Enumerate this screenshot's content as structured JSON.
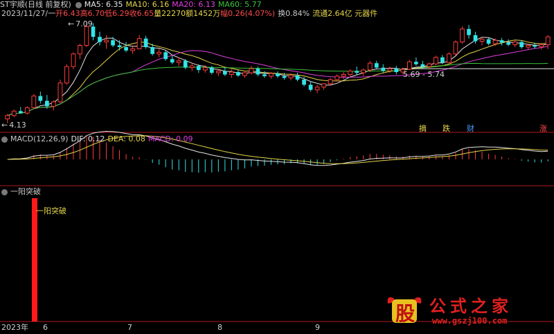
{
  "header": {
    "stock": "ST宇顺(日线 前复权)",
    "ma5": "MA5: 6.35",
    "ma10": "MA10: 6.16",
    "ma20": "MA20: 6.13",
    "ma60": "MA60: 5.77",
    "quote": {
      "date": "2023/11/27/一",
      "open": "开6.43",
      "high": "高6.70",
      "low": "低6.29",
      "close": "收6.65",
      "volume": "量22270",
      "amount": "额1452万",
      "change": "幅0.26(4.07%)",
      "turnover": "换0.84%",
      "float": "流通2.64亿 元器件"
    }
  },
  "macd_header": {
    "name": "MACD(12,26,9)",
    "dif": "DIF: 0.12",
    "dea": "DEA: 0.08",
    "macd": "MACD: 0.09"
  },
  "indicator_header": {
    "name": "一阳突破",
    "bar_label": "一阳突破"
  },
  "price_labels": {
    "high_mark": "7.09",
    "low_mark": "4.13",
    "range_mark": "5.69 - 5.74"
  },
  "markers": [
    "摘",
    "跌",
    "财",
    "涨"
  ],
  "x_axis": [
    "2023年",
    "6",
    "7",
    "8",
    "9"
  ],
  "watermark": {
    "logo_char": "股",
    "brand": "公式之家",
    "url": "www.gszj100.com"
  },
  "colors": {
    "up": "#ff3c3c",
    "down": "#33e3e6",
    "ma5": "#e6e6e6",
    "ma10": "#e6d44a",
    "ma20": "#e03ee0",
    "ma60": "#3cc43c",
    "panel_border": "#b01818",
    "signal": "#ff1a1a"
  },
  "chart_data": {
    "type": "candlestick",
    "title": "ST宇顺(日线 前复权)",
    "x": [
      "2023年",
      "6",
      "7",
      "8",
      "9"
    ],
    "ylim": [
      4.0,
      7.2
    ],
    "candles": [
      {
        "o": 4.25,
        "h": 4.4,
        "l": 4.13,
        "c": 4.35
      },
      {
        "o": 4.35,
        "h": 4.52,
        "l": 4.3,
        "c": 4.48
      },
      {
        "o": 4.48,
        "h": 4.6,
        "l": 4.4,
        "c": 4.42
      },
      {
        "o": 4.42,
        "h": 4.62,
        "l": 4.38,
        "c": 4.58
      },
      {
        "o": 4.58,
        "h": 4.98,
        "l": 4.55,
        "c": 4.92
      },
      {
        "o": 4.92,
        "h": 5.05,
        "l": 4.7,
        "c": 4.78
      },
      {
        "o": 4.78,
        "h": 4.95,
        "l": 4.55,
        "c": 4.62
      },
      {
        "o": 4.62,
        "h": 4.8,
        "l": 4.5,
        "c": 4.75
      },
      {
        "o": 4.75,
        "h": 5.4,
        "l": 4.72,
        "c": 5.3
      },
      {
        "o": 5.3,
        "h": 5.85,
        "l": 5.25,
        "c": 5.78
      },
      {
        "o": 5.78,
        "h": 6.2,
        "l": 5.7,
        "c": 6.15
      },
      {
        "o": 6.15,
        "h": 6.45,
        "l": 6.0,
        "c": 6.4
      },
      {
        "o": 6.4,
        "h": 7.09,
        "l": 6.35,
        "c": 6.95
      },
      {
        "o": 6.95,
        "h": 7.05,
        "l": 6.55,
        "c": 6.65
      },
      {
        "o": 6.65,
        "h": 6.8,
        "l": 6.4,
        "c": 6.5
      },
      {
        "o": 6.5,
        "h": 6.7,
        "l": 6.3,
        "c": 6.55
      },
      {
        "o": 6.55,
        "h": 6.65,
        "l": 6.35,
        "c": 6.4
      },
      {
        "o": 6.4,
        "h": 6.55,
        "l": 6.25,
        "c": 6.35
      },
      {
        "o": 6.35,
        "h": 6.5,
        "l": 6.2,
        "c": 6.25
      },
      {
        "o": 6.25,
        "h": 6.4,
        "l": 6.15,
        "c": 6.3
      },
      {
        "o": 6.3,
        "h": 6.7,
        "l": 6.28,
        "c": 6.6
      },
      {
        "o": 6.6,
        "h": 6.68,
        "l": 6.3,
        "c": 6.35
      },
      {
        "o": 6.35,
        "h": 6.45,
        "l": 6.1,
        "c": 6.15
      },
      {
        "o": 6.15,
        "h": 6.3,
        "l": 6.05,
        "c": 6.2
      },
      {
        "o": 6.2,
        "h": 6.25,
        "l": 5.95,
        "c": 6.0
      },
      {
        "o": 6.0,
        "h": 6.1,
        "l": 5.85,
        "c": 5.9
      },
      {
        "o": 5.9,
        "h": 6.05,
        "l": 5.8,
        "c": 5.95
      },
      {
        "o": 5.95,
        "h": 6.0,
        "l": 5.7,
        "c": 5.75
      },
      {
        "o": 5.75,
        "h": 5.9,
        "l": 5.65,
        "c": 5.8
      },
      {
        "o": 5.8,
        "h": 5.85,
        "l": 5.6,
        "c": 5.68
      },
      {
        "o": 5.68,
        "h": 5.82,
        "l": 5.6,
        "c": 5.75
      },
      {
        "o": 5.75,
        "h": 5.8,
        "l": 5.55,
        "c": 5.6
      },
      {
        "o": 5.6,
        "h": 5.72,
        "l": 5.5,
        "c": 5.65
      },
      {
        "o": 5.65,
        "h": 5.75,
        "l": 5.5,
        "c": 5.55
      },
      {
        "o": 5.55,
        "h": 5.7,
        "l": 5.45,
        "c": 5.62
      },
      {
        "o": 5.62,
        "h": 5.68,
        "l": 5.48,
        "c": 5.52
      },
      {
        "o": 5.52,
        "h": 5.66,
        "l": 5.45,
        "c": 5.6
      },
      {
        "o": 5.6,
        "h": 5.8,
        "l": 5.55,
        "c": 5.72
      },
      {
        "o": 5.72,
        "h": 5.78,
        "l": 5.5,
        "c": 5.55
      },
      {
        "o": 5.55,
        "h": 5.65,
        "l": 5.45,
        "c": 5.5
      },
      {
        "o": 5.5,
        "h": 5.62,
        "l": 5.42,
        "c": 5.58
      },
      {
        "o": 5.58,
        "h": 5.64,
        "l": 5.45,
        "c": 5.5
      },
      {
        "o": 5.5,
        "h": 5.6,
        "l": 5.4,
        "c": 5.45
      },
      {
        "o": 5.45,
        "h": 5.58,
        "l": 5.38,
        "c": 5.52
      },
      {
        "o": 5.52,
        "h": 5.6,
        "l": 5.35,
        "c": 5.4
      },
      {
        "o": 5.4,
        "h": 5.48,
        "l": 5.2,
        "c": 5.25
      },
      {
        "o": 5.25,
        "h": 5.35,
        "l": 5.05,
        "c": 5.1
      },
      {
        "o": 5.1,
        "h": 5.25,
        "l": 5.0,
        "c": 5.18
      },
      {
        "o": 5.18,
        "h": 5.3,
        "l": 5.1,
        "c": 5.28
      },
      {
        "o": 5.28,
        "h": 5.45,
        "l": 5.22,
        "c": 5.4
      },
      {
        "o": 5.4,
        "h": 5.55,
        "l": 5.35,
        "c": 5.5
      },
      {
        "o": 5.5,
        "h": 5.62,
        "l": 5.42,
        "c": 5.55
      },
      {
        "o": 5.55,
        "h": 5.7,
        "l": 5.48,
        "c": 5.65
      },
      {
        "o": 5.65,
        "h": 5.78,
        "l": 5.55,
        "c": 5.6
      },
      {
        "o": 5.6,
        "h": 5.72,
        "l": 5.5,
        "c": 5.68
      },
      {
        "o": 5.68,
        "h": 5.95,
        "l": 5.62,
        "c": 5.88
      },
      {
        "o": 5.88,
        "h": 5.95,
        "l": 5.7,
        "c": 5.75
      },
      {
        "o": 5.75,
        "h": 5.85,
        "l": 5.6,
        "c": 5.66
      },
      {
        "o": 5.66,
        "h": 5.78,
        "l": 5.6,
        "c": 5.72
      },
      {
        "o": 5.72,
        "h": 5.8,
        "l": 5.55,
        "c": 5.62
      },
      {
        "o": 5.62,
        "h": 5.75,
        "l": 5.55,
        "c": 5.7
      },
      {
        "o": 5.7,
        "h": 5.98,
        "l": 5.68,
        "c": 5.92
      },
      {
        "o": 5.92,
        "h": 6.05,
        "l": 5.8,
        "c": 5.85
      },
      {
        "o": 5.85,
        "h": 5.95,
        "l": 5.72,
        "c": 5.78
      },
      {
        "o": 5.78,
        "h": 5.9,
        "l": 5.7,
        "c": 5.86
      },
      {
        "o": 5.86,
        "h": 6.1,
        "l": 5.82,
        "c": 6.05
      },
      {
        "o": 6.05,
        "h": 6.12,
        "l": 5.85,
        "c": 5.9
      },
      {
        "o": 5.9,
        "h": 6.2,
        "l": 5.88,
        "c": 6.15
      },
      {
        "o": 6.15,
        "h": 6.55,
        "l": 6.1,
        "c": 6.5
      },
      {
        "o": 6.5,
        "h": 6.95,
        "l": 6.45,
        "c": 6.88
      },
      {
        "o": 6.88,
        "h": 7.0,
        "l": 6.6,
        "c": 6.7
      },
      {
        "o": 6.7,
        "h": 6.8,
        "l": 6.45,
        "c": 6.52
      },
      {
        "o": 6.52,
        "h": 6.65,
        "l": 6.4,
        "c": 6.58
      },
      {
        "o": 6.58,
        "h": 6.62,
        "l": 6.4,
        "c": 6.45
      },
      {
        "o": 6.45,
        "h": 6.6,
        "l": 6.38,
        "c": 6.55
      },
      {
        "o": 6.55,
        "h": 6.62,
        "l": 6.4,
        "c": 6.48
      },
      {
        "o": 6.48,
        "h": 6.58,
        "l": 6.38,
        "c": 6.42
      },
      {
        "o": 6.42,
        "h": 6.55,
        "l": 6.35,
        "c": 6.5
      },
      {
        "o": 6.5,
        "h": 6.55,
        "l": 6.3,
        "c": 6.35
      },
      {
        "o": 6.35,
        "h": 6.45,
        "l": 6.28,
        "c": 6.4
      },
      {
        "o": 6.4,
        "h": 6.48,
        "l": 6.3,
        "c": 6.36
      },
      {
        "o": 6.36,
        "h": 6.45,
        "l": 6.28,
        "c": 6.42
      },
      {
        "o": 6.42,
        "h": 6.7,
        "l": 6.29,
        "c": 6.65
      }
    ],
    "macd_hist_range": [
      -0.25,
      0.35
    ],
    "signal_bar_index": 3,
    "ma_periods": [
      5,
      10,
      20,
      60
    ]
  }
}
